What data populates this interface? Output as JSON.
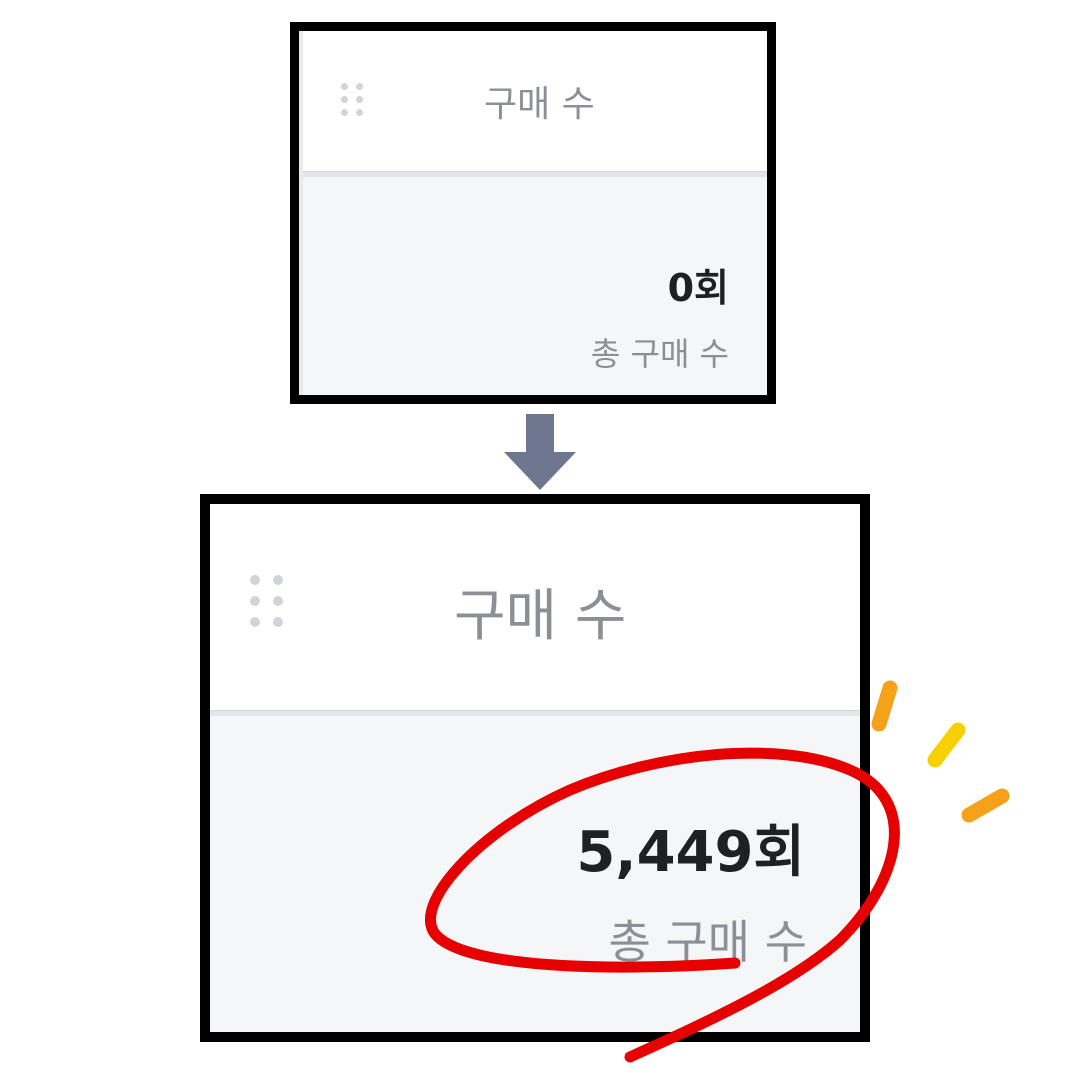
{
  "before_card": {
    "header_title": "구매 수",
    "metric_value": "0회",
    "metric_label": "총 구매 수"
  },
  "after_card": {
    "header_title": "구매 수",
    "metric_value": "5,449회",
    "metric_label": "총 구매 수"
  },
  "icons": {
    "drag_handle": "drag-handle-icon",
    "transition_arrow": "arrow-down-icon"
  },
  "colors": {
    "card_border": "#000000",
    "header_bg": "#ffffff",
    "body_bg": "#f5f6f8",
    "value_text": "#1f2023",
    "label_text": "#8d8f96",
    "arrow": "#6f7790",
    "highlight_circle": "#e60000",
    "sparkle_orange": "#f5a11a",
    "sparkle_yellow": "#f7d000"
  }
}
